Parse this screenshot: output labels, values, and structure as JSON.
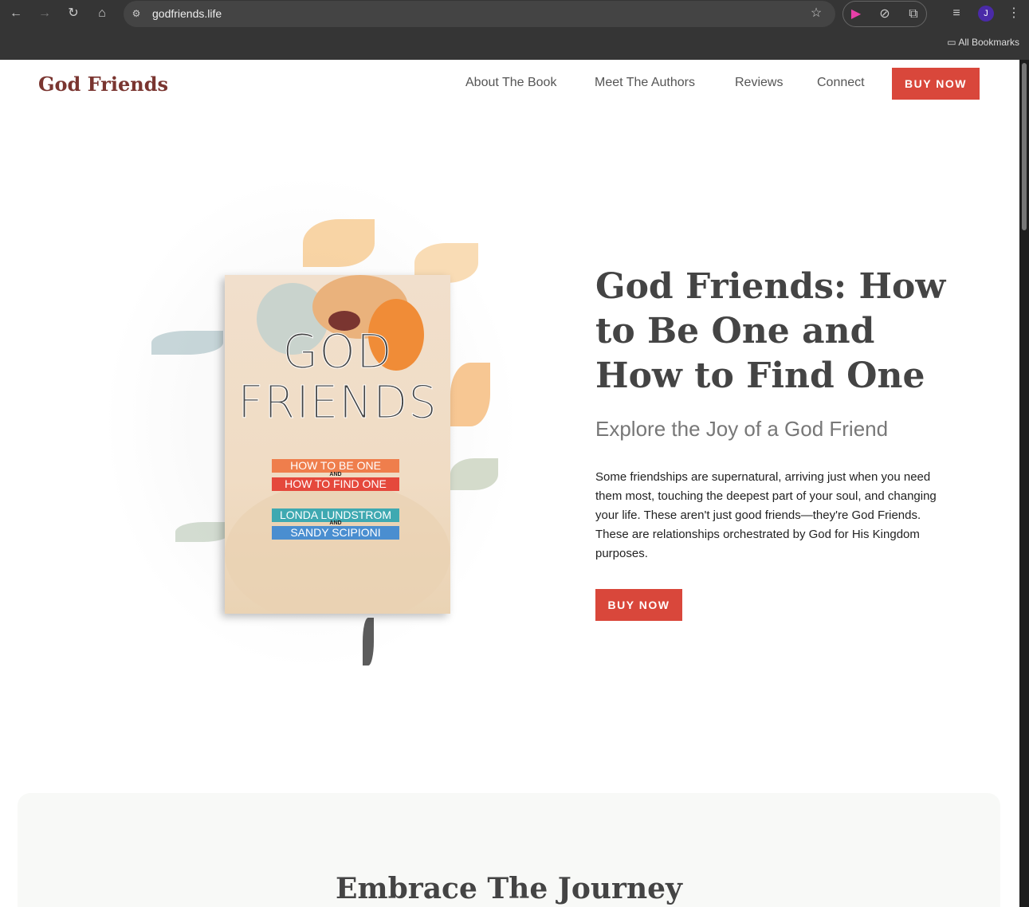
{
  "browser": {
    "url": "godfriends.life",
    "bookmarks_label": "All Bookmarks",
    "profile_initial": "J"
  },
  "header": {
    "logo": "God Friends",
    "nav": [
      "About The Book",
      "Meet The Authors",
      "Reviews",
      "Connect"
    ],
    "buy_label": "BUY NOW"
  },
  "book": {
    "title_line1": "GOD",
    "title_line2": "FRIENDS",
    "subtitle1": "HOW TO BE ONE",
    "and": "AND",
    "subtitle2": "HOW TO FIND ONE",
    "author1": "LONDA LUNDSTROM",
    "author2": "SANDY SCIPIONI",
    "colors": {
      "orange": "#ef7e4c",
      "red": "#e5483c",
      "teal": "#3fa9b1",
      "blue": "#4a8ed0"
    }
  },
  "hero": {
    "title": "God Friends: How to Be One and How to Find One",
    "subtitle": "Explore the Joy of a God Friend",
    "paragraph": "Some friendships are supernatural, arriving just when you need them most, touching the deepest part of your soul, and changing your life. These aren't just good friends—they're God Friends. These are relationships orchestrated by God for His Kingdom purposes.",
    "buy_label": "BUY NOW"
  },
  "section2": {
    "heading": "Embrace The Journey"
  },
  "colors": {
    "accent": "#d9473b",
    "logo": "#7a3530"
  }
}
